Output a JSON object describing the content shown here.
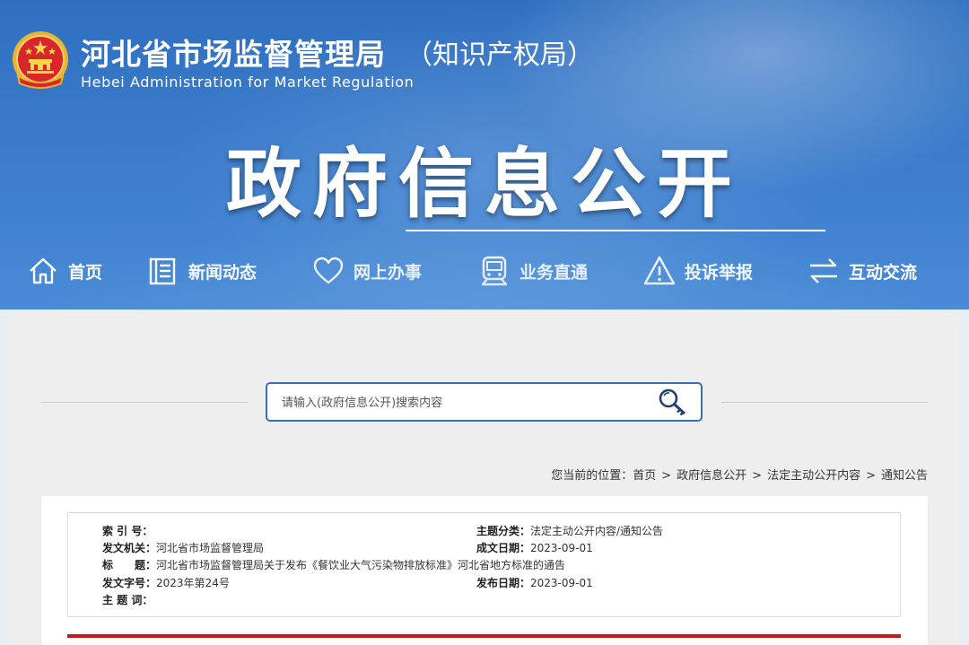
{
  "header": {
    "org_name_cn": "河北省市场监督管理局",
    "org_name_cn_sub": "（知识产权局）",
    "org_name_en": "Hebei Administration for Market Regulation",
    "headline": "政府信息公开"
  },
  "nav": {
    "items": [
      {
        "label": "首页",
        "icon": "home-icon"
      },
      {
        "label": "新闻动态",
        "icon": "news-icon"
      },
      {
        "label": "网上办事",
        "icon": "heart-icon"
      },
      {
        "label": "业务直通",
        "icon": "train-icon"
      },
      {
        "label": "投诉举报",
        "icon": "warning-icon"
      },
      {
        "label": "互动交流",
        "icon": "exchange-icon"
      }
    ]
  },
  "search": {
    "placeholder": "请输入(政府信息公开)搜索内容",
    "icon": "search-key-icon"
  },
  "breadcrumb": {
    "prefix": "您当前的位置：",
    "items": [
      "首页",
      "政府信息公开",
      "法定主动公开内容",
      "通知公告"
    ],
    "separator": ">"
  },
  "meta": {
    "index_label": "索 引 号：",
    "index_value": "",
    "category_label": "主题分类：",
    "category_value": "法定主动公开内容/通知公告",
    "issuer_label": "发文机关：",
    "issuer_value": "河北省市场监督管理局",
    "written_label": "成文日期：",
    "written_value": "2023-09-01",
    "title_label": "标　　题：",
    "title_value": "河北省市场监督管理局关于发布《餐饮业大气污染物排放标准》河北省地方标准的通告",
    "docno_label": "发文字号：",
    "docno_value": "2023年第24号",
    "publish_label": "发布日期：",
    "publish_value": "2023-09-01",
    "keywords_label": "主 题 词：",
    "keywords_value": ""
  },
  "colors": {
    "banner_blue": "#3a7bcb",
    "search_border": "#3a6fb6",
    "accent_red": "#c8161d"
  }
}
